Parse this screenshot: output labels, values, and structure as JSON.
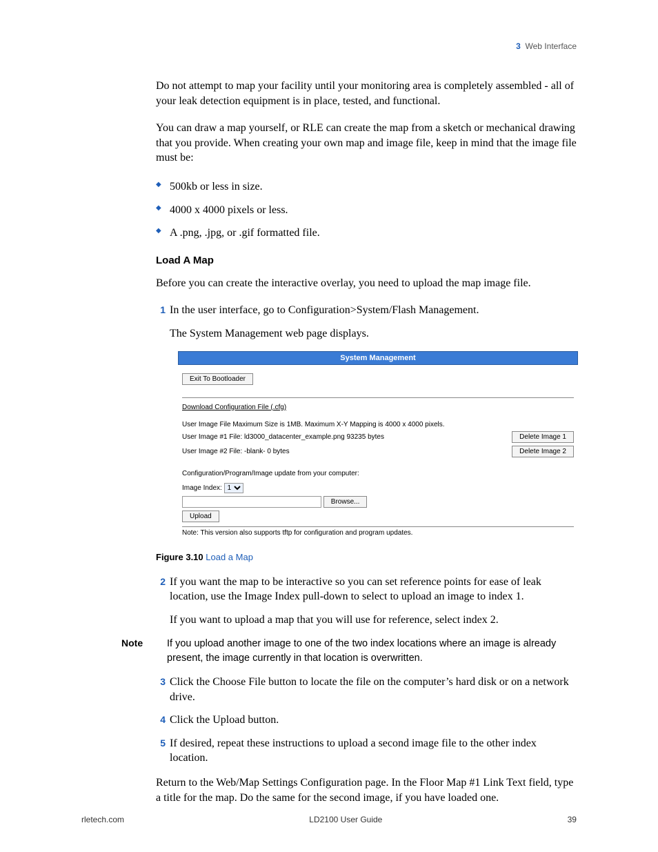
{
  "header": {
    "chapter_num": "3",
    "chapter_title": "Web Interface"
  },
  "para1": "Do not attempt to map your facility until your monitoring area is completely assembled - all of your leak detection equipment is in place, tested, and functional.",
  "para2": "You can draw a map yourself, or RLE can create the map from a sketch or mechanical drawing that you provide. When creating your own map and image file, keep in mind that the image file must be:",
  "bullets": [
    "500kb or less in size.",
    "4000 x 4000 pixels or less.",
    "A .png, .jpg, or .gif formatted file."
  ],
  "heading_load": "Load A Map",
  "para3": "Before you can create the interactive overlay, you need to upload the map image file.",
  "step1": "In the user interface, go to Configuration>System/Flash Management.",
  "step1b": "The System Management web page displays.",
  "figure_label": "Figure 3.10",
  "figure_title": "Load a Map",
  "step2": "If you want the map to be interactive so you can set reference points for ease of leak location, use the Image Index pull-down to select to upload an image to index 1.",
  "step2b": "If you want to upload a map that you will use for reference, select index 2.",
  "note_label": "Note",
  "note_text": "If you upload another image to one of the two index locations where an image is already present, the image currently in that location is overwritten.",
  "step3": "Click the Choose File button to locate the file on the computer’s hard disk or on a network drive.",
  "step4": "Click the Upload button.",
  "step5": "If desired, repeat these instructions to upload a second image file to the other index location.",
  "para_end": "Return to the Web/Map Settings Configuration page. In the Floor Map #1 Link Text field, type a title for the map. Do the same for the second image, if you have loaded one.",
  "sm": {
    "title": "System Management",
    "exit_btn": "Exit To Bootloader",
    "dl_link": "Download Configuration File (.cfg)",
    "size_note": "User Image File Maximum Size is 1MB. Maximum X-Y Mapping is 4000 x 4000 pixels.",
    "img1": "User Image #1 File: ld3000_datacenter_example.png 93235 bytes",
    "img2": "User Image #2 File: -blank- 0 bytes",
    "del1": "Delete Image 1",
    "del2": "Delete Image 2",
    "update_label": "Configuration/Program/Image update from your computer:",
    "index_label": "Image Index:",
    "index_value": "1",
    "browse": "Browse...",
    "upload": "Upload",
    "tftp_note": "Note: This version also supports tftp for configuration and program updates."
  },
  "footer": {
    "left": "rletech.com",
    "center": "LD2100 User Guide",
    "right": "39"
  }
}
